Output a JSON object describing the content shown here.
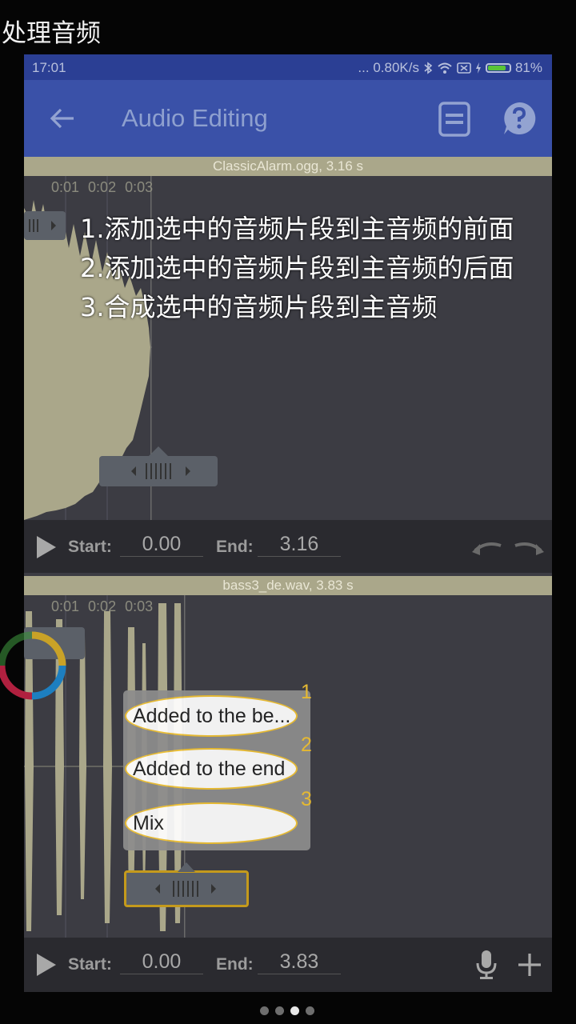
{
  "page_title": "处理音频",
  "status_bar": {
    "time": "17:01",
    "network_speed": "... 0.80K/s",
    "battery": "81%"
  },
  "app_bar": {
    "back_icon": "arrow-left-icon",
    "title": "Audio Editing",
    "save_icon": "save-icon",
    "help_icon": "help-icon"
  },
  "track1": {
    "filename": "ClassicAlarm.ogg, 3.16 s",
    "ticks": [
      "0:01",
      "0:02",
      "0:03"
    ],
    "start_label": "Start:",
    "start_value": "0.00",
    "end_label": "End:",
    "end_value": "3.16"
  },
  "track2": {
    "filename": "bass3_de.wav, 3.83 s",
    "ticks": [
      "0:01",
      "0:02",
      "0:03"
    ],
    "start_label": "Start:",
    "start_value": "0.00",
    "end_label": "End:",
    "end_value": "3.83"
  },
  "instructions": [
    "1.添加选中的音频片段到主音频的前面",
    "2.添加选中的音频片段到主音频的后面",
    "3.合成选中的音频片段到主音频"
  ],
  "popup_menu": {
    "items": [
      {
        "num": "1",
        "label": "Added to the be..."
      },
      {
        "num": "2",
        "label": "Added to the end"
      },
      {
        "num": "3",
        "label": "Mix"
      }
    ]
  },
  "colors": {
    "app_bar": "#3a51a8",
    "status_bar": "#2b3f94",
    "waveform": "#aaa78a",
    "accent": "#f1c232"
  },
  "pager": {
    "count": 4,
    "active": 3
  }
}
